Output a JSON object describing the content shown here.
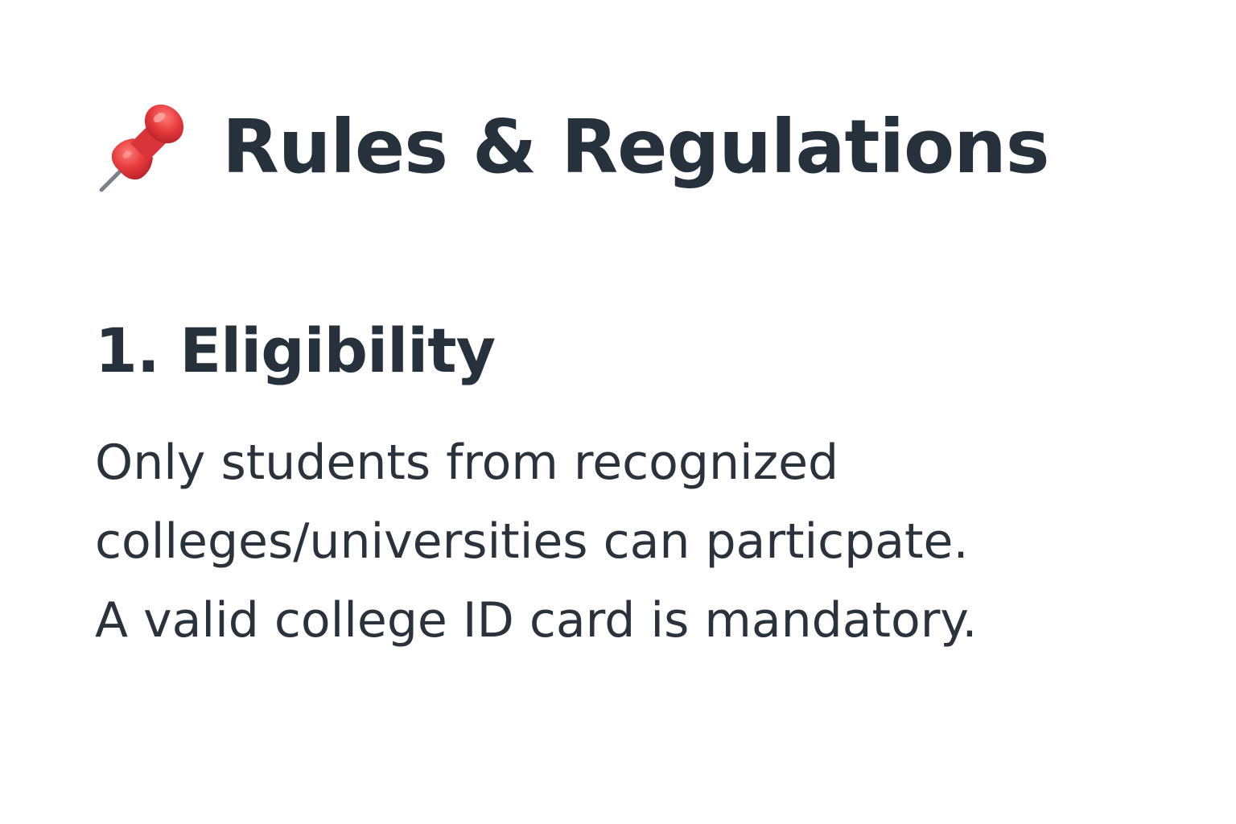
{
  "header": {
    "icon": "pushpin-icon",
    "title": "Rules & Regulations"
  },
  "sections": [
    {
      "heading": "1. Eligibility",
      "lines": [
        "Only students from recognized",
        "colleges/universities can particpate.",
        "A valid college ID card is mandatory."
      ]
    }
  ],
  "colors": {
    "text": "#27313b",
    "pin_red": "#e5393c",
    "background": "#ffffff"
  }
}
